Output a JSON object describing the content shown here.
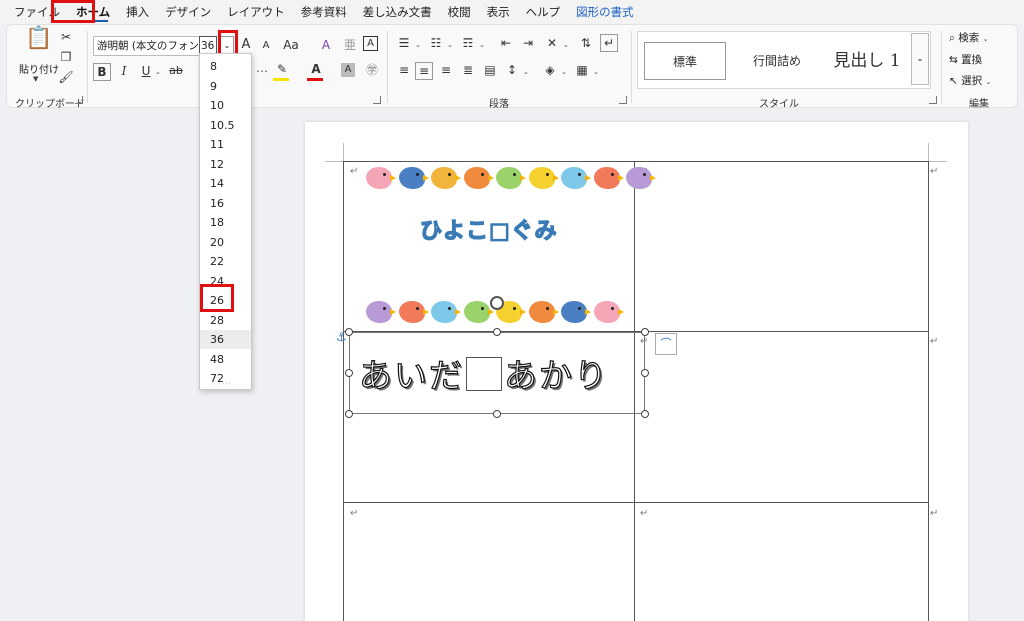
{
  "menu": {
    "tabs": [
      "ファイル",
      "ホーム",
      "挿入",
      "デザイン",
      "レイアウト",
      "参考資料",
      "差し込み文書",
      "校閲",
      "表示",
      "ヘルプ",
      "図形の書式"
    ],
    "active": "ホーム"
  },
  "ribbon": {
    "clipboard": {
      "paste_label": "貼り付け",
      "group_label": "クリップボード"
    },
    "font": {
      "font_name": "游明朝 (本文のフォント",
      "font_size": "36",
      "bold": "B",
      "italic": "I",
      "underline": "U",
      "strike": "ab",
      "grow": "A",
      "shrink": "A",
      "case": "Aa",
      "clear": "A",
      "frame": "A"
    },
    "paragraph": {
      "group_label": "段落"
    },
    "styles": {
      "items": [
        "標準",
        "行間詰め",
        "見出し 1"
      ],
      "group_label": "スタイル"
    },
    "editing": {
      "find": "検索",
      "replace": "置換",
      "select": "選択",
      "group_label": "編集"
    }
  },
  "font_size_dropdown": {
    "options": [
      "8",
      "9",
      "10",
      "10.5",
      "11",
      "12",
      "14",
      "16",
      "18",
      "20",
      "22",
      "24",
      "26",
      "28",
      "36",
      "48",
      "72"
    ],
    "hovered": "36",
    "highlighted": "26"
  },
  "document": {
    "cell_title": "ひよこ□ぐみ",
    "name_part1": "あいだ",
    "name_part2": "あかり",
    "para_mark": "↵",
    "bird_colors_top": [
      "#f4a6b7",
      "#4a7fc4",
      "#f2b43a",
      "#f08a3c",
      "#9ad36a",
      "#f5d130",
      "#7ec8ea",
      "#f07a5a",
      "#b89ad6"
    ],
    "bird_colors_bottom": [
      "#b89ad6",
      "#f07a5a",
      "#7ec8ea",
      "#9ad36a",
      "#f5d130",
      "#f08a3c",
      "#4a7fc4",
      "#f4a6b7"
    ]
  },
  "colors": {
    "accent": "#1a5fb4",
    "highlight_box": "#e01010",
    "font_color_bar": "#e01010",
    "highlight_bar": "#f5e400"
  }
}
